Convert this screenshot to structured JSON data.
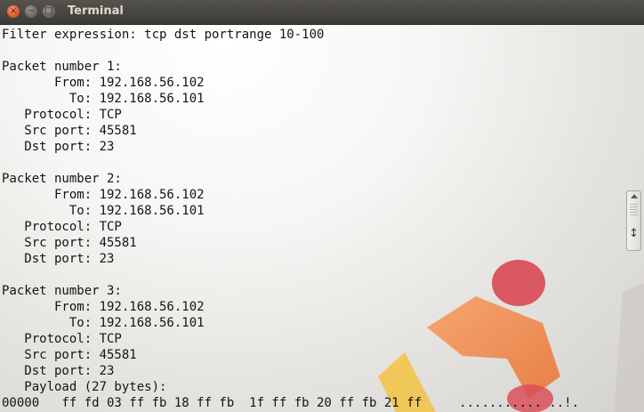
{
  "window": {
    "title": "Terminal",
    "controls": {
      "close_glyph": "×",
      "minimize_glyph": "−",
      "maximize_glyph": "□"
    }
  },
  "terminal": {
    "lines": [
      "Filter expression: tcp dst portrange 10-100",
      "",
      "Packet number 1:",
      "       From: 192.168.56.102",
      "         To: 192.168.56.101",
      "   Protocol: TCP",
      "   Src port: 45581",
      "   Dst port: 23",
      "",
      "Packet number 2:",
      "       From: 192.168.56.102",
      "         To: 192.168.56.101",
      "   Protocol: TCP",
      "   Src port: 45581",
      "   Dst port: 23",
      "",
      "Packet number 3:",
      "       From: 192.168.56.102",
      "         To: 192.168.56.101",
      "   Protocol: TCP",
      "   Src port: 45581",
      "   Dst port: 23",
      "   Payload (27 bytes):",
      "00000   ff fd 03 ff fb 18 ff fb  1f ff fb 20 ff fb 21 ff     ........... ..!."
    ]
  },
  "icons": {
    "scroll_arrow": "↕"
  },
  "colors": {
    "titlebar": "#3c3b37",
    "title_text": "#dfdbd2",
    "close_button": "#e0552b",
    "terminal_text": "#141414",
    "logo_orange": "#f08a4b",
    "logo_red": "#d94c55",
    "logo_yellow": "#f2c44a"
  }
}
